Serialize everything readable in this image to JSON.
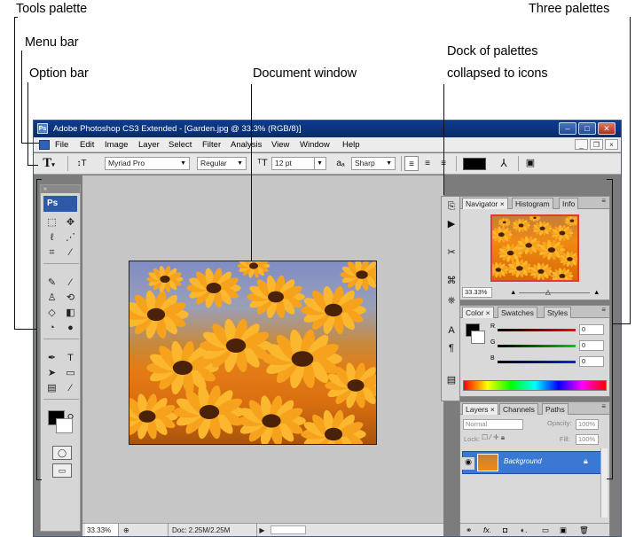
{
  "callouts": {
    "tools_palette": "Tools palette",
    "menu_bar": "Menu bar",
    "option_bar": "Option bar",
    "document_window": "Document window",
    "dock_line1": "Dock of palettes",
    "dock_line2": "collapsed to icons",
    "three_palettes": "Three palettes"
  },
  "window": {
    "title": "Adobe Photoshop CS3 Extended - [Garden.jpg @ 33.3% (RGB/8)]",
    "app_icon": "Ps",
    "minimize": "–",
    "maximize": "□",
    "close": "✕"
  },
  "menu": {
    "items": [
      "File",
      "Edit",
      "Image",
      "Layer",
      "Select",
      "Filter",
      "Analysis",
      "View",
      "Window",
      "Help"
    ],
    "doc_minimize": "_",
    "doc_restore": "❐",
    "doc_close": "×"
  },
  "options": {
    "font_family": "Myriad Pro",
    "font_style": "Regular",
    "font_size": "12 pt",
    "aa_label": "aₐ",
    "antialias": "Sharp"
  },
  "tools": {
    "badge": "Ps",
    "icons": [
      "marquee-tool-icon",
      "move-tool-icon",
      "lasso-tool-icon",
      "magic-wand-tool-icon",
      "crop-tool-icon",
      "slice-tool-icon",
      "healing-brush-tool-icon",
      "brush-tool-icon",
      "clone-stamp-tool-icon",
      "history-brush-tool-icon",
      "eraser-tool-icon",
      "gradient-tool-icon",
      "blur-tool-icon",
      "dodge-tool-icon",
      "pen-tool-icon",
      "type-tool-icon",
      "path-selection-tool-icon",
      "shape-tool-icon",
      "notes-tool-icon",
      "eyedropper-tool-icon",
      "hand-tool-icon",
      "zoom-tool-icon"
    ]
  },
  "status": {
    "zoom": "33.33%",
    "doc": "Doc: 2.25M/2.25M"
  },
  "navigator": {
    "tabs": [
      "Navigator",
      "Histogram",
      "Info"
    ],
    "zoom": "33.33%"
  },
  "color": {
    "tabs": [
      "Color",
      "Swatches",
      "Styles"
    ],
    "r_label": "R",
    "r_value": "0",
    "g_label": "G",
    "g_value": "0",
    "b_label": "B",
    "b_value": "0"
  },
  "layers": {
    "tabs": [
      "Layers",
      "Channels",
      "Paths"
    ],
    "blend_mode": "Normal",
    "opacity_label": "Opacity:",
    "opacity_value": "100%",
    "lock_label": "Lock:",
    "fill_label": "Fill:",
    "fill_value": "100%",
    "layer_name": "Background"
  },
  "colors": {
    "titlebar": "#0d3c8f",
    "workspace": "#7c7c7c",
    "layer_selected": "#3a78d4",
    "photo_orange": "#e47b14"
  }
}
